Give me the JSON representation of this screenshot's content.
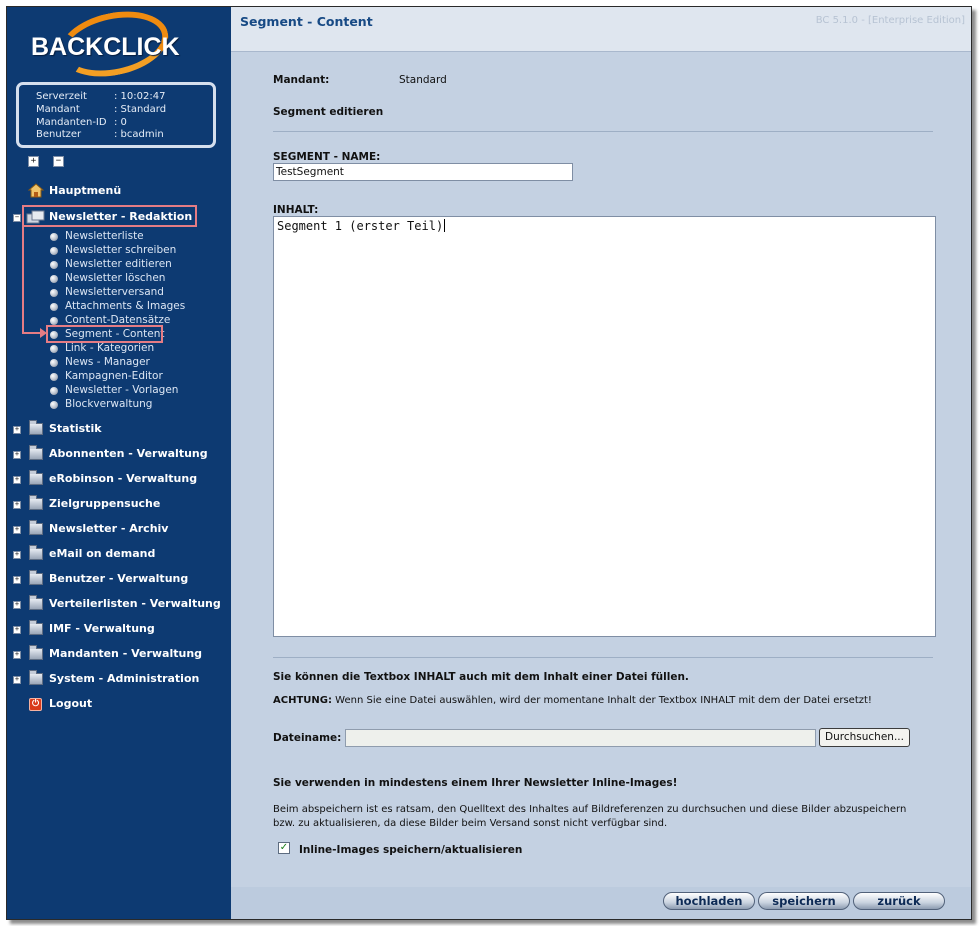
{
  "app": {
    "logo": "BACKCLICK",
    "version": "BC 5.1.0 - [Enterprise Edition]"
  },
  "info": [
    {
      "key": "Serverzeit",
      "value": ": 10:02:47"
    },
    {
      "key": "Mandant",
      "value": ": Standard"
    },
    {
      "key": "Mandanten-ID",
      "value": ": 0"
    },
    {
      "key": "Benutzer",
      "value": ": bcadmin"
    }
  ],
  "nav": {
    "home": "Hauptmenü",
    "redaktion": {
      "label": "Newsletter - Redaktion",
      "items": [
        "Newsletterliste",
        "Newsletter schreiben",
        "Newsletter editieren",
        "Newsletter löschen",
        "Newsletterversand",
        "Attachments & Images",
        "Content-Datensätze",
        "Segment - Content",
        "Link - Kategorien",
        "News - Manager",
        "Kampagnen-Editor",
        "Newsletter - Vorlagen",
        "Blockverwaltung"
      ]
    },
    "sections": [
      "Statistik",
      "Abonnenten - Verwaltung",
      "eRobinson - Verwaltung",
      "Zielgruppensuche",
      "Newsletter - Archiv",
      "eMail on demand",
      "Benutzer - Verwaltung",
      "Verteilerlisten - Verwaltung",
      "IMF - Verwaltung",
      "Mandanten - Verwaltung",
      "System - Administration"
    ],
    "logout": "Logout"
  },
  "page": {
    "title": "Segment - Content",
    "mandant_label": "Mandant:",
    "mandant_value": "Standard",
    "section_title": "Segment editieren",
    "name_label": "SEGMENT - NAME:",
    "name_value": "TestSegment",
    "content_label": "INHALT:",
    "content_value": "Segment 1 (erster Teil)",
    "file_hint": "Sie können die Textbox INHALT auch mit dem Inhalt einer Datei füllen.",
    "warning_label": "ACHTUNG:",
    "warning_text": "Wenn Sie eine Datei auswählen, wird der momentane Inhalt der Textbox INHALT mit dem der Datei ersetzt!",
    "file_label": "Dateiname:",
    "browse_label": "Durchsuchen...",
    "inline_title": "Sie verwenden in mindestens einem Ihrer Newsletter Inline-Images!",
    "inline_text_1": "Beim abspeichern ist es ratsam, den Quelltext des Inhaltes auf Bildreferenzen zu durchsuchen und diese Bilder abzuspeichern",
    "inline_text_2": "bzw. zu aktualisieren, da diese Bilder beim Versand sonst nicht verfügbar sind.",
    "inline_checkbox_label": "Inline-Images speichern/aktualisieren",
    "inline_checkbox_checked": true
  },
  "buttons": {
    "upload": "hochladen",
    "save": "speichern",
    "back": "zurück"
  },
  "colors": {
    "sidebar": "#0d3a72",
    "content": "#c4d1e2",
    "highlight": "#e57c84",
    "title": "#174a85",
    "logo_swoosh": "#ef8b10"
  }
}
